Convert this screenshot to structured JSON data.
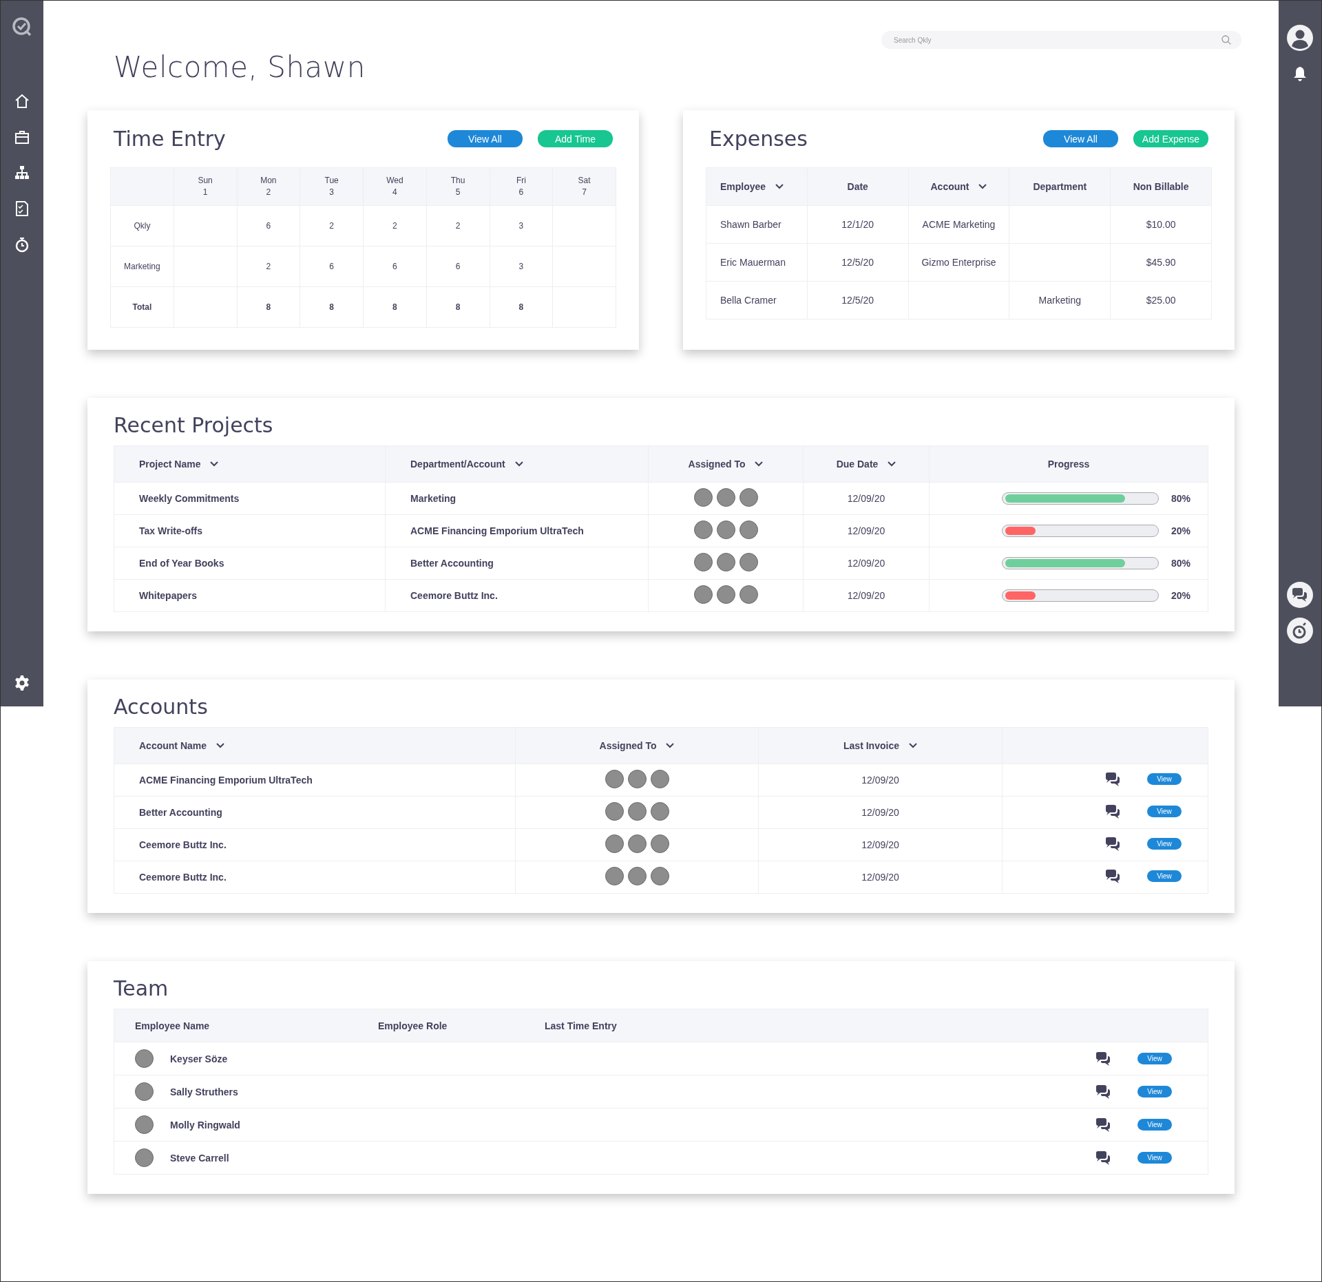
{
  "search": {
    "placeholder": "Search Qkly"
  },
  "greeting": "Welcome, Shawn",
  "time_entry": {
    "title": "Time Entry",
    "buttons": [
      {
        "label": "View All",
        "kind": "primary"
      },
      {
        "label": "Add Time",
        "kind": "success"
      }
    ],
    "columns": [
      {
        "day": "Sun",
        "date": "1"
      },
      {
        "day": "Mon",
        "date": "2"
      },
      {
        "day": "Tue",
        "date": "3"
      },
      {
        "day": "Wed",
        "date": "4"
      },
      {
        "day": "Thu",
        "date": "5"
      },
      {
        "day": "Fri",
        "date": "6"
      },
      {
        "day": "Sat",
        "date": "7"
      }
    ],
    "rows": [
      {
        "label": "Qkly",
        "kind": "entry",
        "cells": [
          null,
          "6",
          "2",
          "2",
          "2",
          "3",
          null
        ]
      },
      {
        "label": "Marketing",
        "kind": "entry",
        "cells": [
          null,
          "2",
          "6",
          "6",
          "6",
          "3",
          null
        ]
      },
      {
        "label": "Total",
        "kind": "total",
        "cells": [
          null,
          "8",
          "8",
          "8",
          "8",
          "8",
          null
        ]
      }
    ]
  },
  "expenses": {
    "title": "Expenses",
    "buttons": [
      {
        "label": "View All",
        "kind": "primary"
      },
      {
        "label": "Add Expense",
        "kind": "success"
      }
    ],
    "columns": [
      {
        "label": "Employee",
        "sortable": true
      },
      {
        "label": "Date",
        "sortable": false
      },
      {
        "label": "Account",
        "sortable": true
      },
      {
        "label": "Department",
        "sortable": false
      },
      {
        "label": "Non Billable",
        "sortable": false
      }
    ],
    "rows": [
      {
        "cells": [
          "Shawn Barber",
          "12/1/20",
          "ACME Marketing",
          null,
          "$10.00"
        ]
      },
      {
        "cells": [
          "Eric Mauerman",
          "12/5/20",
          "Gizmo Enterprise",
          null,
          "$45.90"
        ]
      },
      {
        "cells": [
          "Bella Cramer",
          "12/5/20",
          null,
          "Marketing",
          "$25.00"
        ]
      }
    ]
  },
  "recent_projects": {
    "title": "Recent Projects",
    "columns": [
      {
        "label": "Project Name",
        "sortable": true
      },
      {
        "label": "Department/Account",
        "sortable": true
      },
      {
        "label": "Assigned To",
        "sortable": true
      },
      {
        "label": "Due Date",
        "sortable": true
      },
      {
        "label": "Progress",
        "sortable": false
      }
    ],
    "rows": [
      {
        "name": "Weekly Commitments",
        "department": "Marketing",
        "due": "12/09/20",
        "progress": {
          "level": 0.8,
          "reading": "80%",
          "color": "#6fcf9c"
        }
      },
      {
        "name": "Tax Write-offs",
        "department": "ACME Financing Emporium UltraTech",
        "due": "12/09/20",
        "progress": {
          "level": 0.2,
          "reading": "20%",
          "color": "#ff6565"
        }
      },
      {
        "name": "End of Year Books",
        "department": "Better Accounting",
        "due": "12/09/20",
        "progress": {
          "level": 0.8,
          "reading": "80%",
          "color": "#6fcf9c"
        }
      },
      {
        "name": "Whitepapers",
        "department": "Ceemore Buttz Inc.",
        "due": "12/09/20",
        "progress": {
          "level": 0.2,
          "reading": "20%",
          "color": "#ff6565"
        }
      }
    ]
  },
  "accounts": {
    "title": "Accounts",
    "columns": [
      {
        "label": "Account Name",
        "sortable": true
      },
      {
        "label": "Assigned To",
        "sortable": true
      },
      {
        "label": "Last Invoice",
        "sortable": true
      }
    ],
    "rows": [
      {
        "name": "ACME Financing Emporium UltraTech",
        "last_invoice": "12/09/20",
        "action": "View"
      },
      {
        "name": "Better Accounting",
        "last_invoice": "12/09/20",
        "action": "View"
      },
      {
        "name": "Ceemore Buttz Inc.",
        "last_invoice": "12/09/20",
        "action": "View"
      },
      {
        "name": "Ceemore Buttz Inc.",
        "last_invoice": "12/09/20",
        "action": "View"
      }
    ]
  },
  "team": {
    "title": "Team",
    "columns": [
      "Employee Name",
      "Employee Role",
      "Last Time Entry"
    ],
    "rows": [
      {
        "name": "Keyser Söze",
        "action": "View"
      },
      {
        "name": "Sally Struthers",
        "action": "View"
      },
      {
        "name": "Molly Ringwald",
        "action": "View"
      },
      {
        "name": "Steve Carrell",
        "action": "View"
      }
    ]
  }
}
